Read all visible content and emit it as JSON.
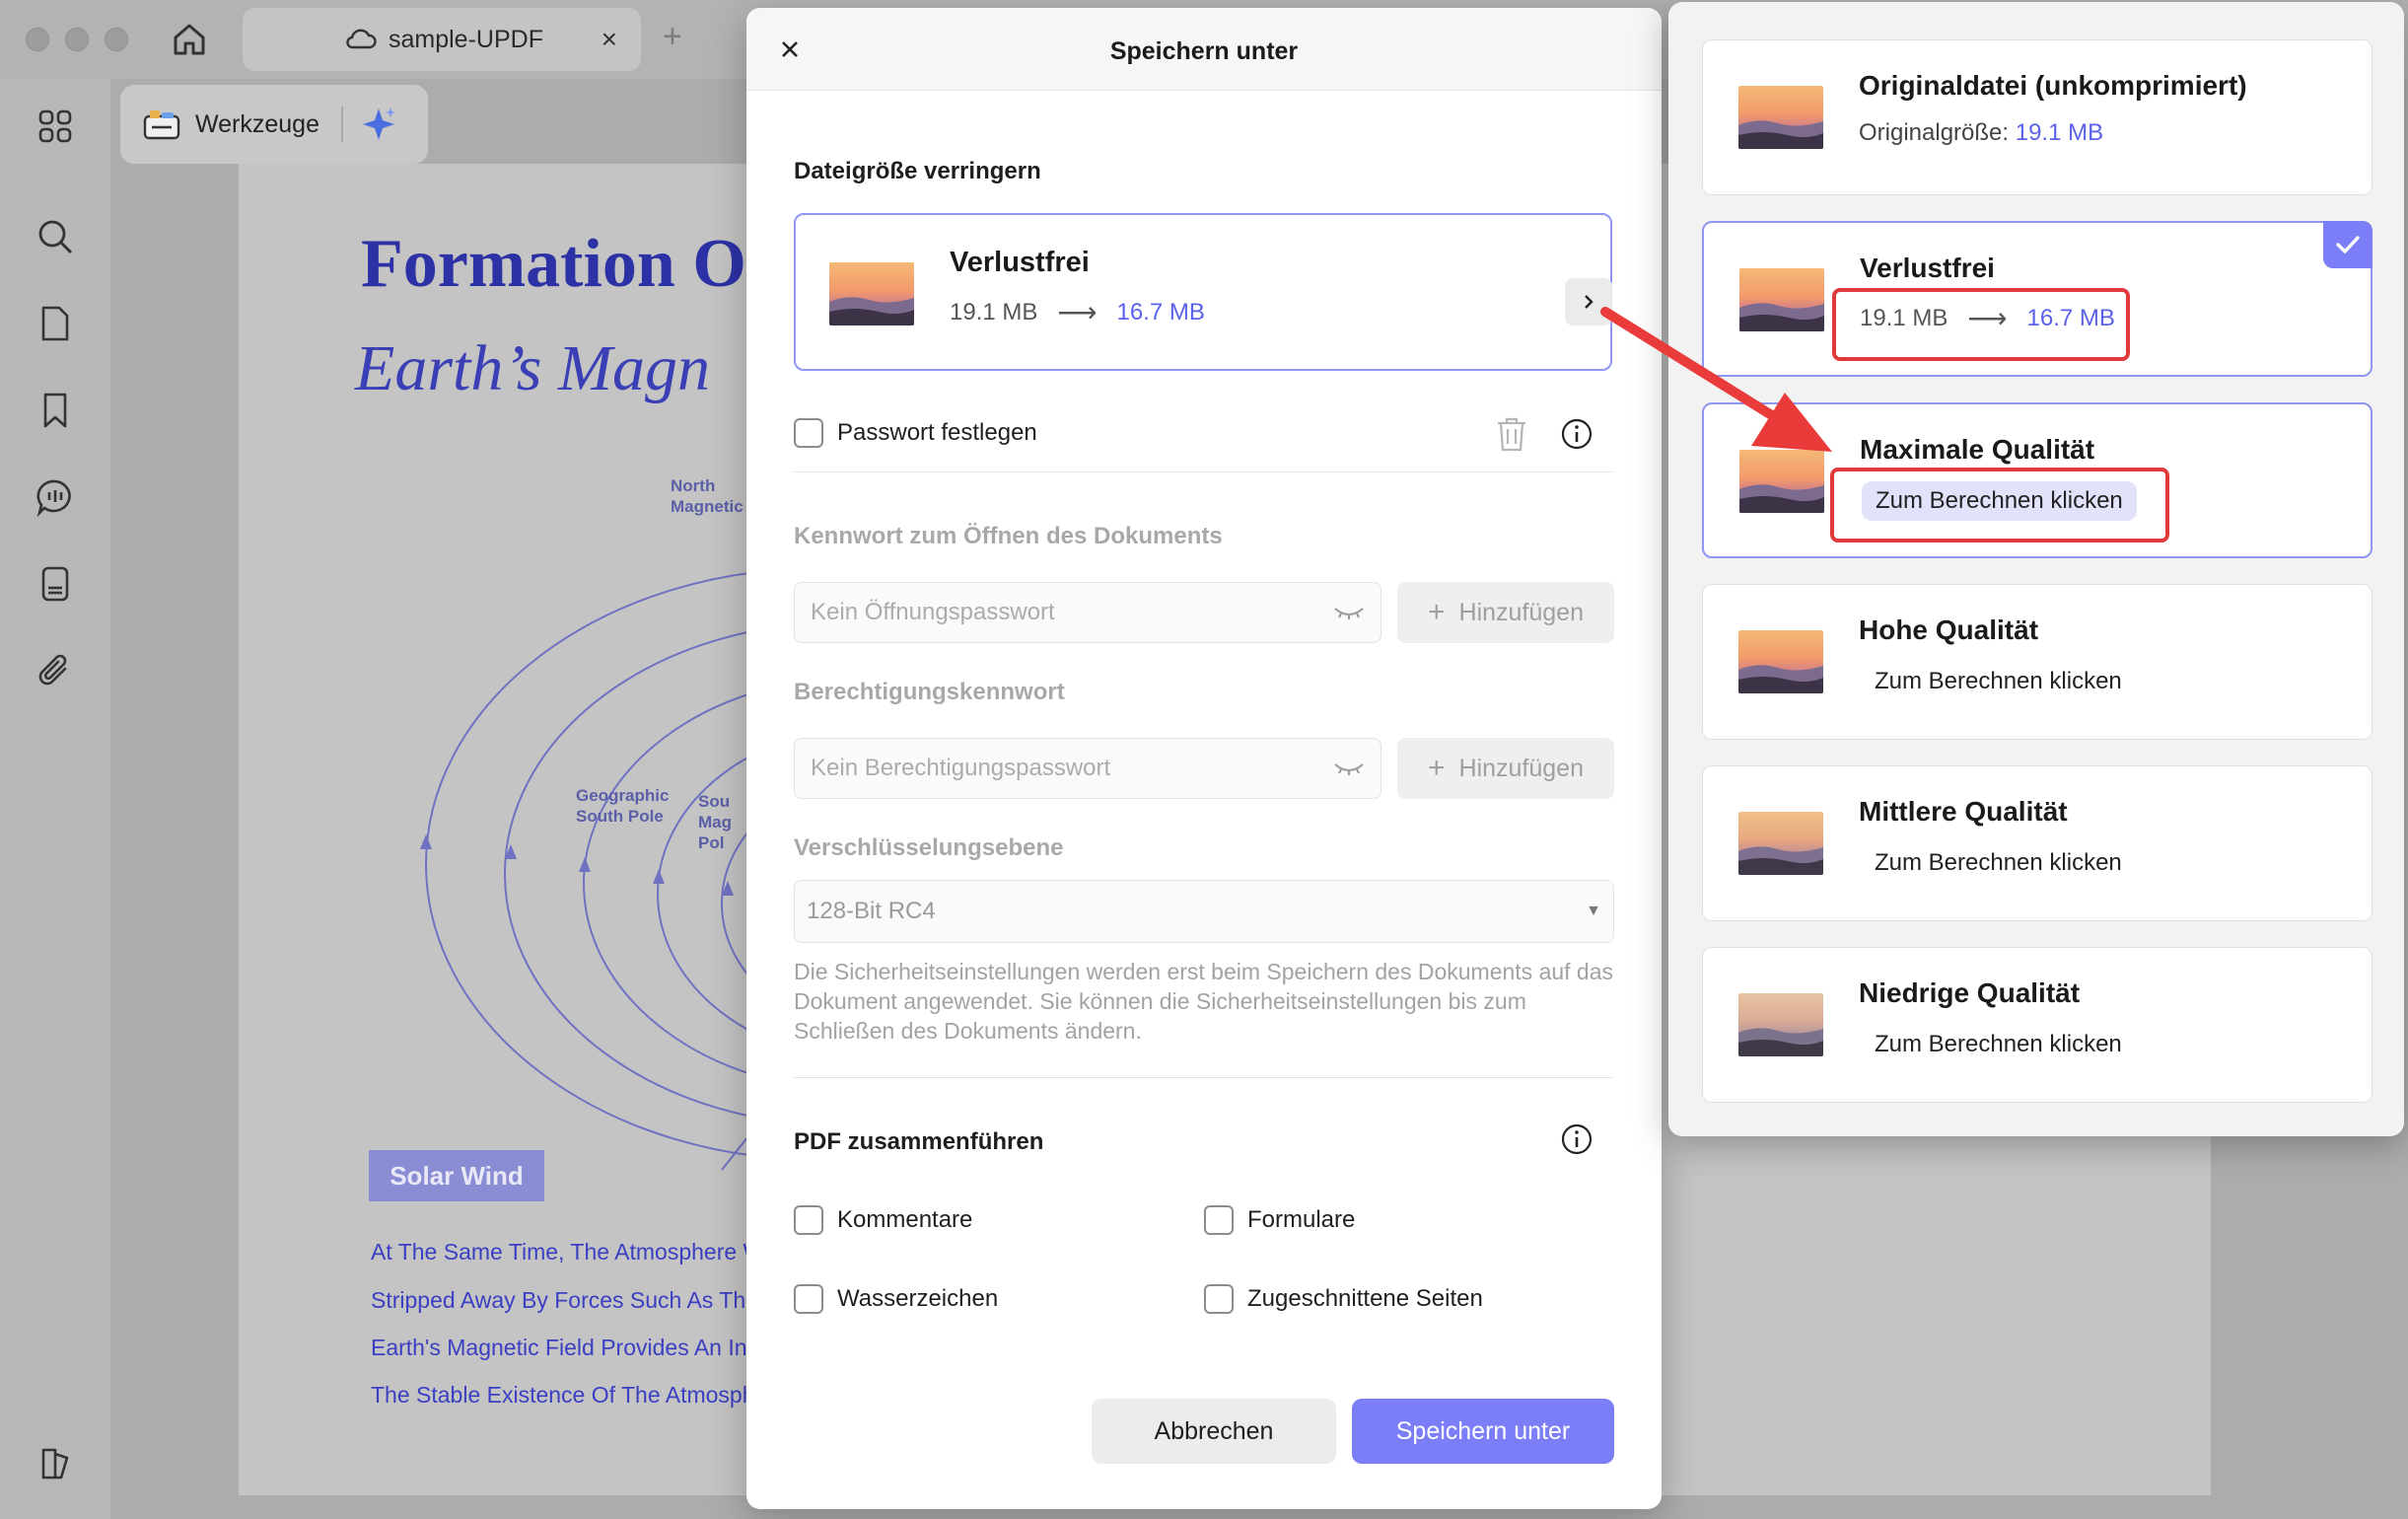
{
  "titlebar": {
    "tab_label": "sample-UPDF",
    "tab_close": "×",
    "new_tab": "+"
  },
  "toolbar": {
    "tools_label": "Werkzeuge"
  },
  "pdf": {
    "title": "Formation O",
    "subtitle": "Earth’s Magn",
    "label_north": [
      "North",
      "Magnetic"
    ],
    "label_geo_south": [
      "Geographic",
      "South Pole"
    ],
    "label_south_mag": [
      "Sou",
      "Mag",
      "Pol"
    ],
    "solar_wind": "Solar Wind",
    "lines": [
      "At The Same Time, The Atmosphere W",
      "Stripped Away By Forces Such As The",
      "Earth's Magnetic Field Provides An Ind",
      "The Stable Existence Of The Atmosph"
    ]
  },
  "dialog": {
    "title": "Speichern unter",
    "reduce_section": "Dateigröße verringern",
    "reduce_option": {
      "name": "Verlustfrei",
      "from": "19.1 MB",
      "arrow": "⟶",
      "to": "16.7 MB"
    },
    "set_password": "Passwort festlegen",
    "open_pw_label": "Kennwort zum Öffnen des Dokuments",
    "open_pw_placeholder": "Kein Öffnungspasswort",
    "perm_pw_label": "Berechtigungskennwort",
    "perm_pw_placeholder": "Kein Berechtigungspasswort",
    "add_label": "Hinzufügen",
    "encryption_label": "Verschlüsselungsebene",
    "encryption_value": "128-Bit RC4",
    "security_note": "Die Sicherheitseinstellungen werden erst beim Speichern des Dokuments auf das Dokument angewendet. Sie können die Sicherheitseinstellungen bis zum Schließen des Dokuments ändern.",
    "merge_section": "PDF zusammenführen",
    "merge_options": [
      "Kommentare",
      "Formulare",
      "Wasserzeichen",
      "Zugeschnittene Seiten"
    ],
    "cancel": "Abbrechen",
    "save": "Speichern unter"
  },
  "popover": {
    "options": [
      {
        "name": "Originaldatei (unkomprimiert)",
        "sub_prefix": "Originalgröße: ",
        "sub_value": "19.1 MB"
      },
      {
        "name": "Verlustfrei",
        "from": "19.1 MB",
        "arrow": "⟶",
        "to": "16.7 MB",
        "selected": true
      },
      {
        "name": "Maximale Qualität",
        "action": "Zum Berechnen klicken"
      },
      {
        "name": "Hohe Qualität",
        "action": "Zum Berechnen klicken"
      },
      {
        "name": "Mittlere Qualität",
        "action": "Zum Berechnen klicken"
      },
      {
        "name": "Niedrige Qualität",
        "action": "Zum Berechnen klicken"
      }
    ]
  },
  "colors": {
    "accent": "#7b7ef7",
    "link_blue": "#5a61e8",
    "highlight_red": "#e0393d"
  },
  "icons": {
    "home": "home-icon",
    "cloud": "cloud-icon",
    "grid": "apps-grid-icon",
    "search": "search-icon",
    "page": "page-icon",
    "bookmark": "bookmark-icon",
    "comment": "comment-icon",
    "form": "form-icon",
    "attachment": "paperclip-icon",
    "layers": "layers-icon",
    "sparkle": "ai-sparkle-icon",
    "close": "close-icon",
    "chevron": "chevron-right-icon",
    "trash": "trash-icon",
    "info": "info-icon",
    "eye": "eye-closed-icon",
    "checkmark": "checkmark-icon"
  }
}
